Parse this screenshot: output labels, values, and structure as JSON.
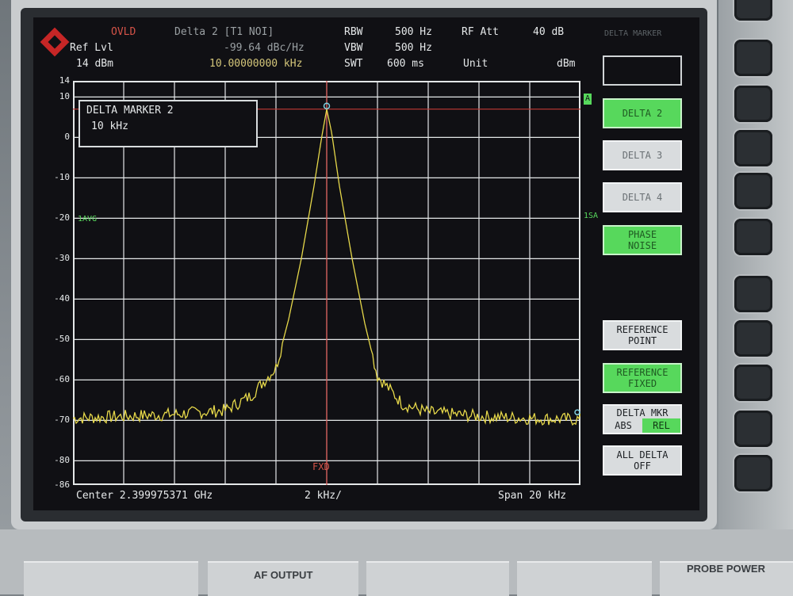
{
  "header": {
    "ovld": "OVLD",
    "ref_lvl_label": "Ref Lvl",
    "ref_lvl_value": "14 dBm",
    "marker_title": "Delta 2 [T1 NOI]",
    "marker_level": "-99.64 dBc/Hz",
    "marker_freq": "10.00000000 kHz",
    "rbw_label": "RBW",
    "rbw_value": "500 Hz",
    "vbw_label": "VBW",
    "vbw_value": "500 Hz",
    "swt_label": "SWT",
    "swt_value": "600 ms",
    "rf_att_label": "RF Att",
    "rf_att_value": "40 dB",
    "unit_label": "Unit",
    "unit_value": "dBm",
    "top_right_label": "DELTA MARKER"
  },
  "plot": {
    "y_ticks": [
      "14",
      "10",
      "0",
      "-10",
      "-20",
      "-30",
      "-40",
      "-50",
      "-60",
      "-70",
      "-80",
      "-86"
    ],
    "trace_label_a": "A",
    "trace_label_1avg": "1AVG",
    "trace_label_1sa": "1SA",
    "fxd_label": "FXD",
    "marker_box_title": "DELTA MARKER 2",
    "marker_box_value": "10 kHz"
  },
  "footer": {
    "center": "Center 2.399975371 GHz",
    "div": "2 kHz/",
    "span": "Span 20 kHz"
  },
  "softkeys": [
    {
      "label": "",
      "state": "blank"
    },
    {
      "label": "DELTA 2",
      "state": "green"
    },
    {
      "label": "DELTA 3",
      "state": "off"
    },
    {
      "label": "DELTA 4",
      "state": "off"
    },
    {
      "label": "PHASE\nNOISE",
      "state": "green"
    },
    {
      "label": "REFERENCE\nPOINT",
      "state": "on"
    },
    {
      "label": "REFERENCE\nFIXED",
      "state": "green"
    },
    {
      "label": "DELTA MKR",
      "state": "split",
      "left": "ABS",
      "right": "REL"
    },
    {
      "label": "ALL DELTA\nOFF",
      "state": "on"
    }
  ],
  "panel": {
    "af_output": "AF OUTPUT",
    "probe_power": "PROBE POWER"
  },
  "colors": {
    "trace": "#e6d84a",
    "grid": "#e4e7e8",
    "ref_line": "#c23a34",
    "fxd_line": "#d9534f",
    "softkey_green": "#57d85c"
  },
  "chart_data": {
    "type": "line",
    "title": "",
    "xlabel": "",
    "ylabel": "",
    "x_center_ghz": 2.399975371,
    "x_span_khz": 20,
    "x_div_khz": 2,
    "ylim": [
      -86,
      14
    ],
    "y_unit": "dBm",
    "ref_level_dbm": 7,
    "grid": true,
    "series": [
      {
        "x_khz": [
          -10,
          -8,
          -6,
          -4,
          -3,
          -2,
          -1.5,
          -1,
          -0.5,
          -0.2,
          0,
          0.2,
          0.5,
          1,
          1.5,
          2,
          3,
          4,
          6,
          8,
          10
        ],
        "values": [
          -69.5,
          -69,
          -68.5,
          -67.5,
          -64,
          -57,
          -45,
          -30,
          -12,
          0,
          7,
          1,
          -12,
          -30,
          -46,
          -59,
          -66,
          -68,
          -69,
          -69.5,
          -69.8
        ]
      }
    ]
  }
}
